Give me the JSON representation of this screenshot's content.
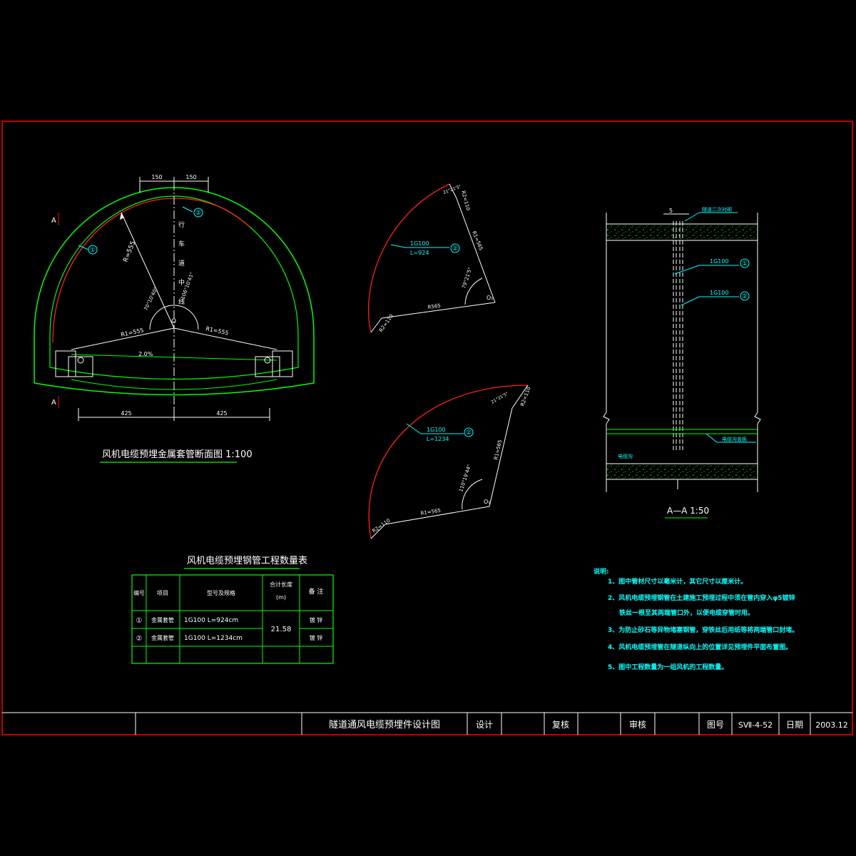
{
  "section": {
    "title": "风机电缆预埋金属套管断面图 1:100",
    "dim_top_left": "150",
    "dim_top_right": "150",
    "dim_bottom_left": "425",
    "dim_bottom_right": "425",
    "section_mark_top": "A",
    "section_mark_bottom": "A",
    "radius_main": "R=555",
    "radius_r1_left": "R1=555",
    "radius_r1_right": "R1=555",
    "angle_left": "70°10'40\"",
    "angle_right": "106°10'41\"",
    "center_label": "O",
    "slope": "2.0%",
    "lane_center": [
      "行",
      "车",
      "道",
      "中",
      "线"
    ],
    "callout_1": "①",
    "callout_2": "②"
  },
  "detail_top": {
    "pipe": "1G100",
    "length": "L=924",
    "callout": "②",
    "r1": "R1=565",
    "r": "R565",
    "r2_top": "R2=110",
    "r2_bottom": "R2=110",
    "angle_main": "79°21'5\"",
    "angle_top": "21°21'5\"",
    "center": "O₁"
  },
  "detail_bottom": {
    "pipe": "1G100",
    "length": "L=1234",
    "callout": "②",
    "r1_side": "R1=565",
    "r1_bottom": "R1=565",
    "r2_top": "R2=110",
    "r2_bottom": "R2=110",
    "angle_main": "110°19'44\"",
    "angle_top": "21°21'5\"",
    "center": "O₁"
  },
  "aa_section": {
    "dim": "5",
    "lining_label": "隧道二次衬砌",
    "pipe1": "1G100",
    "pipe2": "1G100",
    "callout_1": "①",
    "callout_2": "②",
    "trench_cover": "电缆沟盖板",
    "trench": "电缆沟",
    "title": "A—A  1:50"
  },
  "table": {
    "title": "风机电缆预埋钢管工程数量表",
    "headers": [
      "编号",
      "项目",
      "型号及规格",
      "合计长度",
      "(m)",
      "备 注"
    ],
    "rows": [
      {
        "no": "①",
        "item": "金属套管",
        "spec": "1G100   L=924cm",
        "note": "镀 锌"
      },
      {
        "no": "②",
        "item": "金属套管",
        "spec": "1G100   L=1234cm",
        "note": "镀 锌"
      }
    ],
    "total": "21.58"
  },
  "notes": {
    "heading": "说明:",
    "lines": [
      "1、图中管材尺寸以毫米计，其它尺寸以厘米计。",
      "2、风机电缆预埋钢管在土建施工预埋过程中须在管内穿入φ5镀锌",
      "铁丝一根至其两端管口外，以便电缆穿管时用。",
      "3、为防止砂石等异物堵塞钢管，穿铁丝后用纸等将两端管口封堵。",
      "4、风机电缆预埋管在隧道纵向上的位置详见预埋件平面布置图。",
      "5、图中工程数量为一组风机的工程数量。"
    ]
  },
  "title_block": {
    "drawing_title": "隧道通风电缆预埋件设计图",
    "design": "设计",
    "review": "复核",
    "approve": "审核",
    "drawing_no_label": "图号",
    "drawing_no": "SⅦ-4-52",
    "date_label": "日期",
    "date": "2003.12"
  },
  "colors": {
    "frame": "#ff0000",
    "green": "#00ff00",
    "cyan": "#00ffff",
    "white": "#ffffff",
    "red_arc": "#ff2020"
  }
}
